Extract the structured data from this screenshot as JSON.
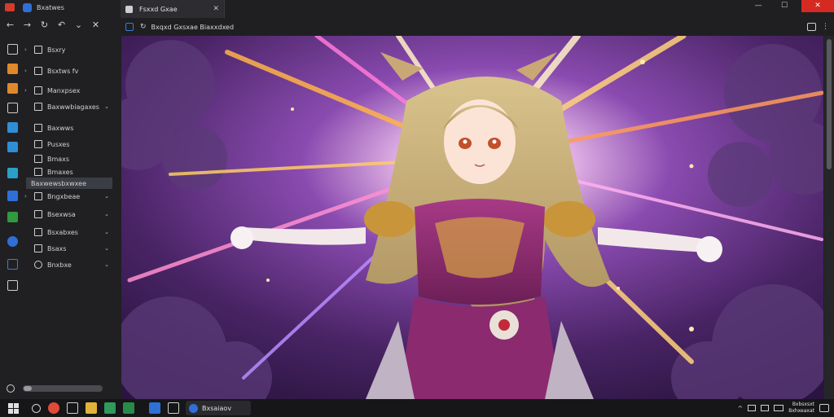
{
  "left_titlebar": {
    "tab_label": "Bxatwes"
  },
  "left_nav": {
    "buttons": [
      "←",
      "→",
      "↻",
      "↶",
      "⌄",
      "✕"
    ]
  },
  "tree": {
    "items": [
      {
        "label": "Bsxry",
        "expanded": true,
        "caret": "v"
      },
      {
        "label": "Bsxtws fv",
        "expanded": true
      },
      {
        "label": "Manxpsex",
        "expanded": true
      },
      {
        "label": "Baxwwbiagaxes",
        "caret": "⌄"
      },
      {
        "label": "Baxwws"
      },
      {
        "label": "Pusxes"
      },
      {
        "label": "Bmaxs"
      },
      {
        "label": "Bmaxes"
      },
      {
        "label": "Baxwewsbxwxee",
        "selected": true
      },
      {
        "label": "Bngxbeae",
        "caret": "⌄"
      },
      {
        "label": "Bsexwsa",
        "caret": "⌄"
      },
      {
        "label": "Bsxabxes",
        "caret": "⌄"
      },
      {
        "label": "Bsaxs",
        "caret": "⌄"
      },
      {
        "label": "Bnxbxe",
        "caret": "⌄"
      }
    ]
  },
  "browser": {
    "tab_label": "Fsxxd Gxae",
    "tab_close": "✕",
    "window_controls": {
      "minimize": "—",
      "maximize": "☐",
      "close": "✕"
    },
    "reload_symbol": "↻",
    "url": "Bxqxd Gxsxae Biaxxdxed",
    "menu_symbol": "⋮"
  },
  "artwork": {
    "description": "anime heroine with long blonde hair and winged ears, purple-and-gold armor, arms outstretched before radiant light beams on a purple cloud background",
    "colors": {
      "bg_dark": "#3b1e52",
      "bg_mid": "#6a3a8a",
      "glow": "#ffe9c8",
      "armor_purple": "#8b2a6e",
      "armor_gold": "#c9953a",
      "hair": "#c9b27a"
    }
  },
  "taskbar": {
    "active_task_label": "Bxsaiaov",
    "tray": {
      "chevron": "^",
      "time": "Bxbsxsxt",
      "date": "Bxhxeaxat"
    }
  },
  "theme": {
    "accent": "#2f6fd6",
    "close_red": "#d52a22"
  }
}
